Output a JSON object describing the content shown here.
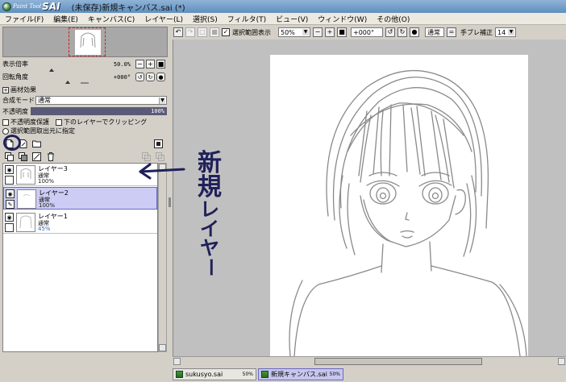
{
  "app": {
    "logo_small": "Paint Tool",
    "logo_big": "SAI",
    "window_title": "(未保存)新規キャンバス.sai (*)"
  },
  "menu": [
    "ファイル(F)",
    "編集(E)",
    "キャンバス(C)",
    "レイヤー(L)",
    "選択(S)",
    "フィルタ(T)",
    "ビュー(V)",
    "ウィンドウ(W)",
    "その他(O)"
  ],
  "nav": {
    "zoom_label": "表示倍率",
    "zoom_value": "50.0%",
    "rotate_label": "回転角度",
    "rotate_value": "+000°"
  },
  "texture": {
    "section": "画材効果",
    "blend_label": "合成モード",
    "blend_value": "通常",
    "opacity_label": "不透明度",
    "opacity_value": "100%",
    "preserve_opacity": "不透明度保護",
    "clip_lower": "下のレイヤーでクリッピング",
    "source_select": "選択範囲取出元に指定"
  },
  "layers": [
    {
      "name": "レイヤー3",
      "mode": "通常",
      "opacity": "100%",
      "selected": false
    },
    {
      "name": "レイヤー2",
      "mode": "通常",
      "opacity": "100%",
      "selected": true
    },
    {
      "name": "レイヤー1",
      "mode": "通常",
      "opacity": "45%",
      "selected": false
    }
  ],
  "toolbar": {
    "selection_display": "選択範囲表示",
    "zoom": "50%",
    "angle": "+000°",
    "mode": "通常",
    "stabilizer_label": "手ブレ補正",
    "stabilizer_value": "14"
  },
  "tabs": [
    {
      "name": "sukusyo.sai",
      "zoom": "50%",
      "active": false
    },
    {
      "name": "新規キャンバス.sai",
      "zoom": "50%",
      "active": true
    }
  ],
  "annotation": {
    "text_line1": "新",
    "text_line2": "規",
    "text_line3": "レ",
    "text_line4": "イ",
    "text_line5": "ヤ",
    "text_line6": "ー"
  },
  "colors": {
    "selected_layer": "#ccccf4",
    "annotation_ink": "#20205a",
    "canvas_bg": "#c0c0c0"
  }
}
